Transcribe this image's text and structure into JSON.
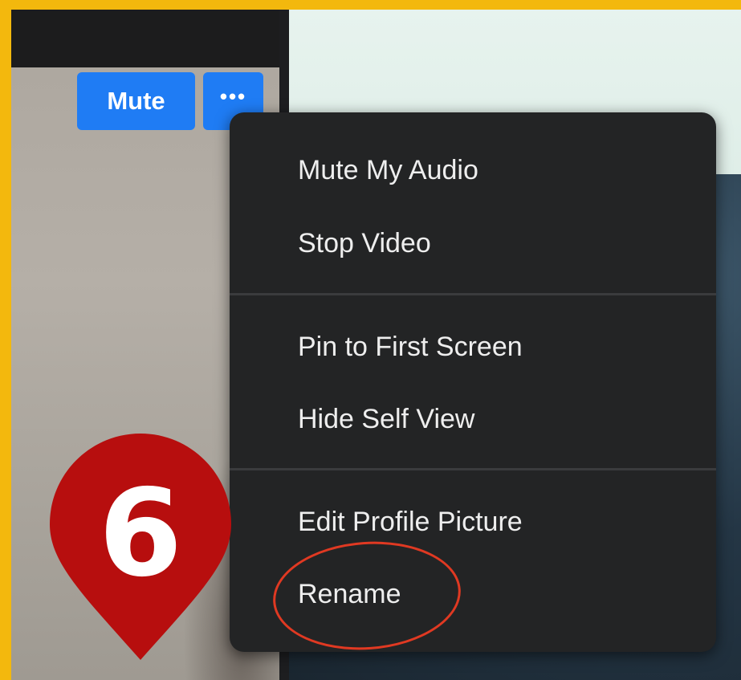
{
  "buttons": {
    "mute_label": "Mute",
    "more_label": "•••"
  },
  "menu": {
    "items": [
      {
        "label": "Mute My Audio"
      },
      {
        "label": "Stop Video"
      },
      {
        "label": "Pin to First Screen"
      },
      {
        "label": "Hide Self View"
      },
      {
        "label": "Edit Profile Picture"
      },
      {
        "label": "Rename"
      }
    ]
  },
  "step_marker": {
    "number": "6",
    "icon": "location-pin-icon"
  },
  "colors": {
    "frame_border": "#f3b80d",
    "button_blue": "#1f7cf4",
    "menu_bg": "#232425",
    "highlight_red": "#e03922",
    "pin_red": "#b70e0e"
  }
}
